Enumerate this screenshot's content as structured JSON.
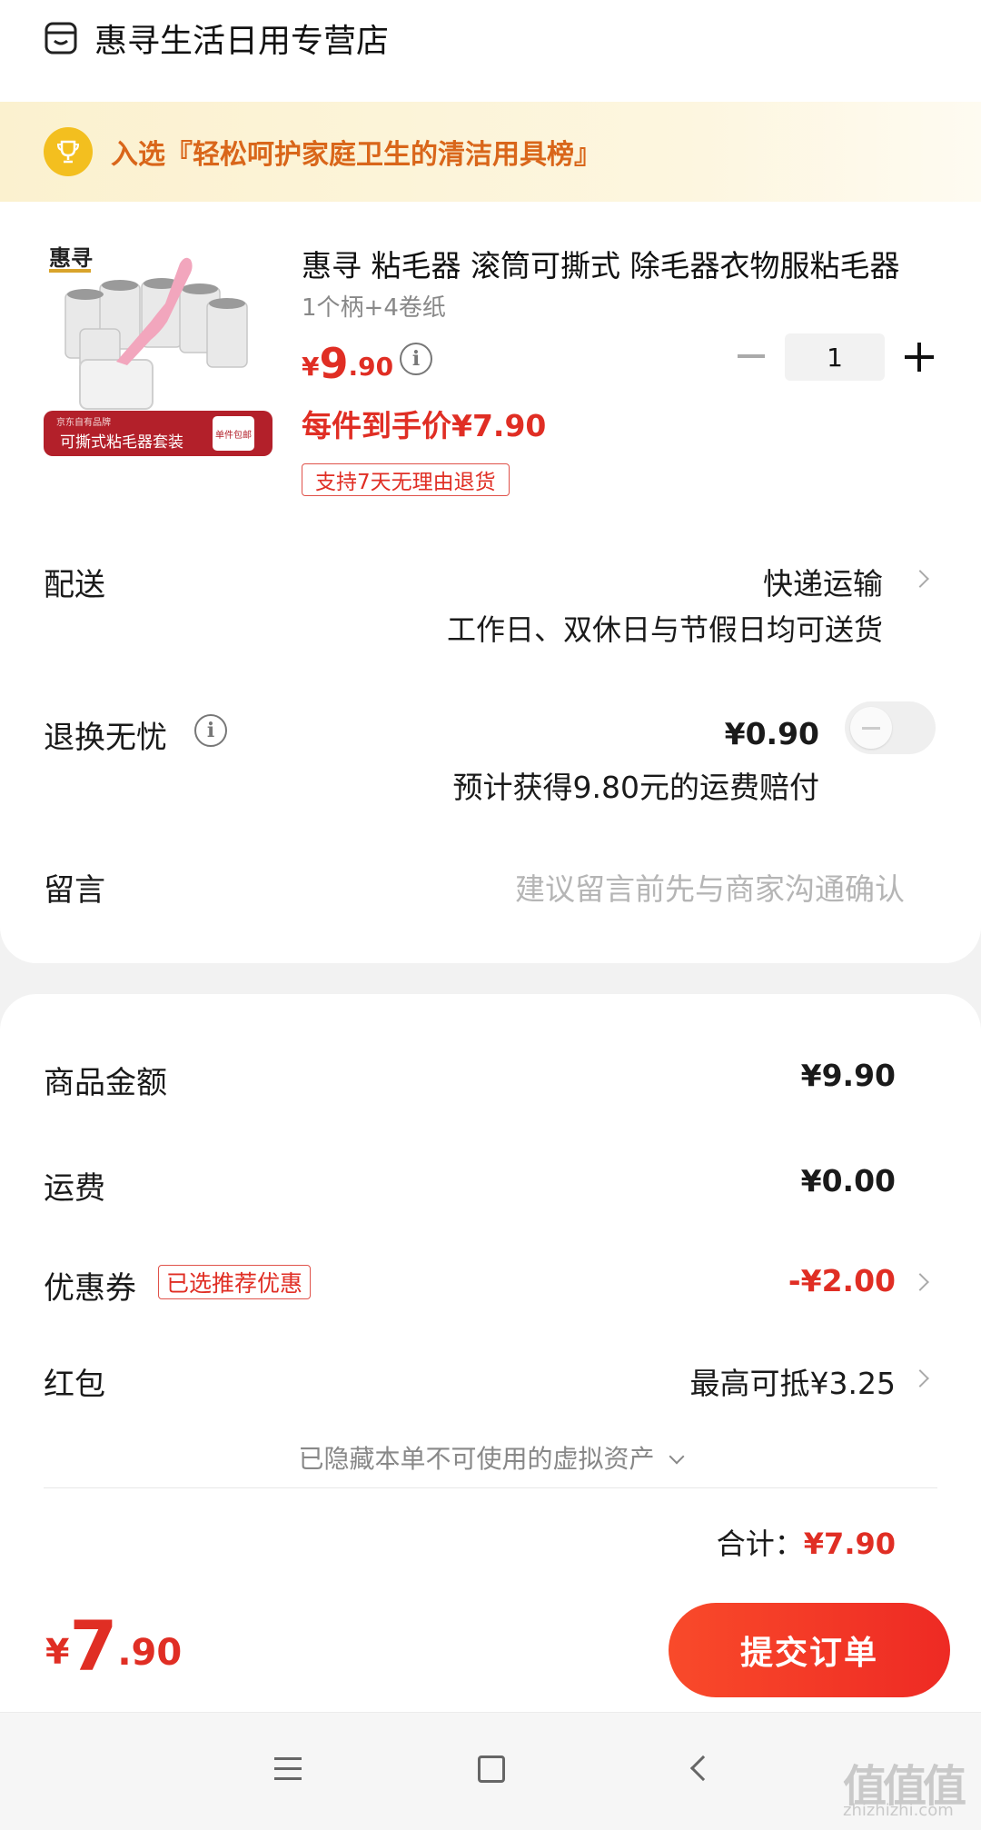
{
  "store": {
    "name": "惠寻生活日用专营店",
    "icon": "store-icon"
  },
  "banner": {
    "text": "入选『轻松呵护家庭卫生的清洁用具榜』",
    "icon": "trophy-icon"
  },
  "product": {
    "image_brand": "惠寻",
    "image_caption": "可撕式粘毛器套装",
    "image_badge": "单件包邮",
    "image_small": "京东自有品牌",
    "title": "惠寻 粘毛器 滚筒可撕式 除毛器衣物服粘毛器",
    "spec": "1个柄+4卷纸",
    "price_yen": "¥",
    "price_int": "9",
    "price_dec": ".90",
    "quantity": "1",
    "each_price": "每件到手价¥7.90",
    "return_tag": "支持7天无理由退货"
  },
  "delivery": {
    "label": "配送",
    "method": "快递运输",
    "note": "工作日、双休日与节假日均可送货"
  },
  "return_insurance": {
    "label": "退换无忧",
    "price": "¥0.90",
    "note": "预计获得9.80元的运费赔付",
    "enabled": false
  },
  "message": {
    "label": "留言",
    "placeholder": "建议留言前先与商家沟通确认"
  },
  "summary": {
    "goods_label": "商品金额",
    "goods_value": "¥9.90",
    "shipping_label": "运费",
    "shipping_value": "¥0.00",
    "coupon_label": "优惠券",
    "coupon_tag": "已选推荐优惠",
    "coupon_value": "-¥2.00",
    "redpacket_label": "红包",
    "redpacket_value": "最高可抵¥3.25",
    "hidden_assets": "已隐藏本单不可使用的虚拟资产",
    "total_label": "合计：",
    "total_value": "¥7.90"
  },
  "bottom": {
    "price_yen": "¥",
    "price_int": "7",
    "price_dec": ".90",
    "submit": "提交订单"
  },
  "watermark": {
    "main": "值值值",
    "sub": "zhizhizhi.com"
  },
  "colors": {
    "accent": "#e02e24",
    "banner_text": "#d9661a",
    "trophy": "#f3bf1f"
  }
}
